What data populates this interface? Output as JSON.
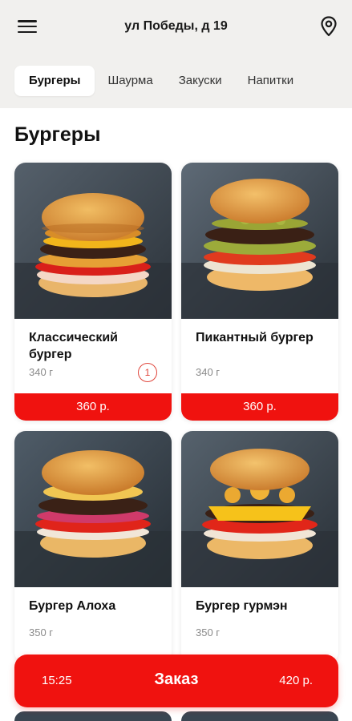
{
  "header": {
    "address": "ул Победы, д 19",
    "menu_icon": "hamburger-menu-icon",
    "location_icon": "map-pin-icon"
  },
  "tabs": [
    {
      "label": "Бургеры",
      "active": true
    },
    {
      "label": "Шаурма",
      "active": false
    },
    {
      "label": "Закуски",
      "active": false
    },
    {
      "label": "Напитки",
      "active": false
    }
  ],
  "section": {
    "title": "Бургеры"
  },
  "products": [
    {
      "name": "Классический бургер",
      "weight": "340 г",
      "price": "360 р.",
      "in_cart": "1"
    },
    {
      "name": "Пикантный бургер",
      "weight": "340 г",
      "price": "360 р."
    },
    {
      "name": "Бургер Алоха",
      "weight": "350 г"
    },
    {
      "name": "Бургер гурмэн",
      "weight": "350 г"
    }
  ],
  "order": {
    "time": "15:25",
    "label": "Заказ",
    "total": "420 р."
  },
  "colors": {
    "accent": "#f0120f",
    "badge": "#e0453b",
    "topbar_bg": "#f1f0ee"
  }
}
